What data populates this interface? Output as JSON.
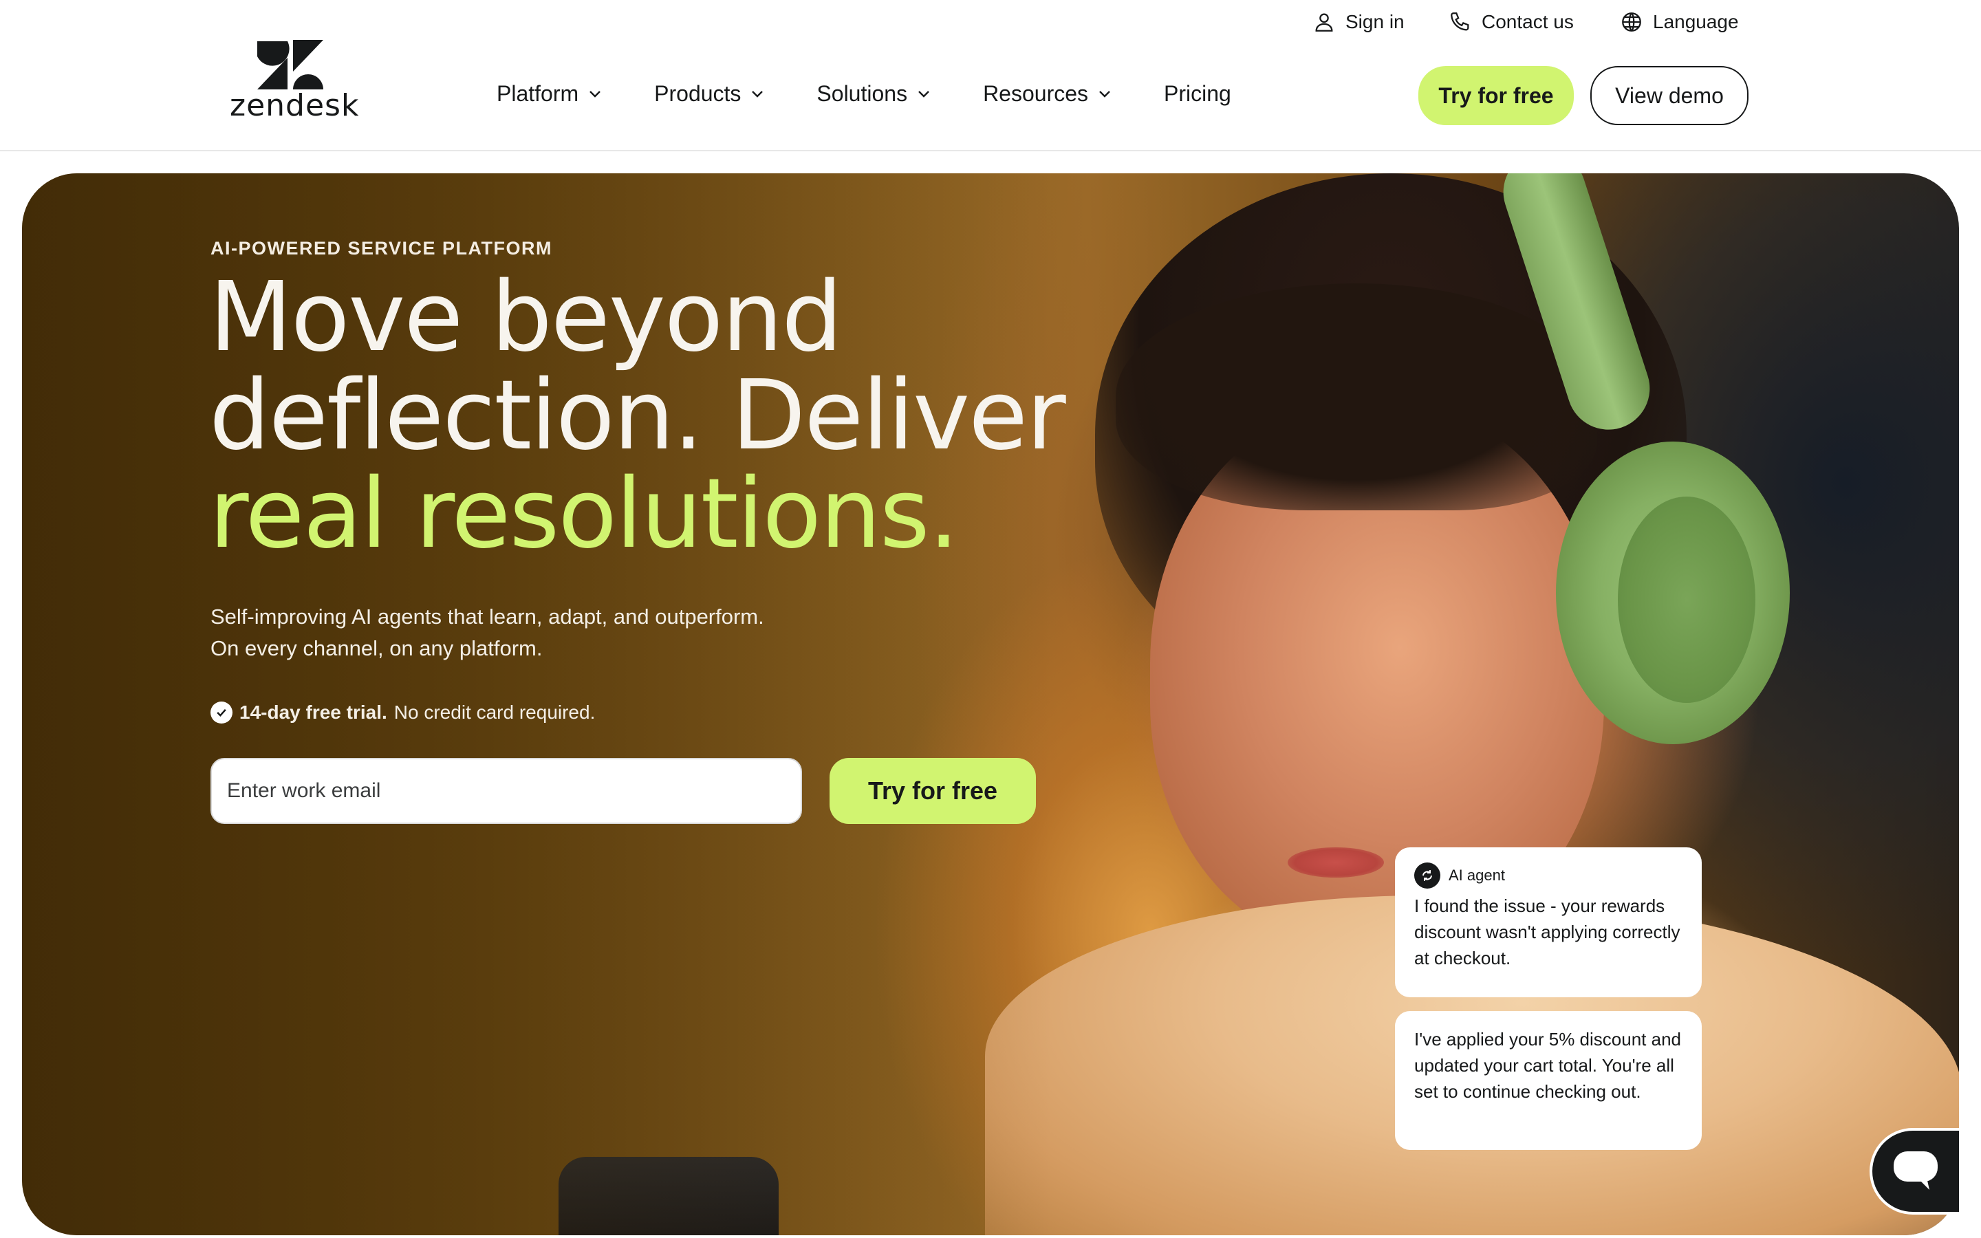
{
  "utility_bar": {
    "sign_in": "Sign in",
    "contact": "Contact us",
    "language": "Language"
  },
  "brand": {
    "name": "zendesk"
  },
  "nav": {
    "items": [
      {
        "label": "Platform",
        "has_menu": true
      },
      {
        "label": "Products",
        "has_menu": true
      },
      {
        "label": "Solutions",
        "has_menu": true
      },
      {
        "label": "Resources",
        "has_menu": true
      },
      {
        "label": "Pricing",
        "has_menu": false
      }
    ],
    "try_free": "Try for free",
    "view_demo": "View demo"
  },
  "hero": {
    "eyebrow": "AI-POWERED SERVICE PLATFORM",
    "headline_line1": "Move beyond",
    "headline_line2": "deflection. Deliver",
    "headline_line3": "real resolutions.",
    "subhead_line1": "Self-improving AI agents that learn, adapt, and outperform.",
    "subhead_line2": "On every channel, on any platform.",
    "trial_bold": "14-day free trial.",
    "trial_rest": "No credit card required.",
    "email_placeholder": "Enter work email",
    "cta": "Try for free"
  },
  "chat": {
    "agent_label": "AI agent",
    "message_1": "I found the issue - your rewards discount wasn't applying correctly at checkout.",
    "message_2": "I've applied your 5% discount and updated your cart total. You're all set to continue checking out."
  },
  "colors": {
    "accent": "#d1f470",
    "text_dark": "#17191a",
    "hero_text": "#f7f4ee"
  },
  "icons": {
    "sign_in": "user-icon",
    "contact": "phone-icon",
    "language": "globe-icon",
    "nav_caret": "chevron-down-icon",
    "trial": "check-circle-icon",
    "agent": "ai-agent-icon",
    "launcher": "chat-bubble-icon"
  }
}
